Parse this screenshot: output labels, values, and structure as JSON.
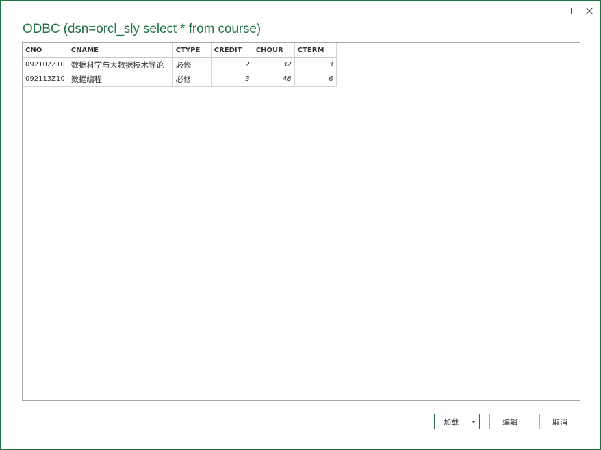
{
  "window": {
    "title": "ODBC (dsn=orcl_sly select * from course)",
    "accent_color": "#217346"
  },
  "controls": {
    "maximize_icon": "maximize-icon",
    "close_icon": "close-icon",
    "close_glyph": "✕"
  },
  "table": {
    "columns": [
      "CNO",
      "CNAME",
      "CTYPE",
      "CREDIT",
      "CHOUR",
      "CTERM"
    ],
    "rows": [
      {
        "cno": "092102Z10",
        "cname": "数据科学与大数据技术导论",
        "ctype": "必修",
        "credit": "2",
        "chour": "32",
        "cterm": "3"
      },
      {
        "cno": "092113Z10",
        "cname": "数据编程",
        "ctype": "必修",
        "credit": "3",
        "chour": "48",
        "cterm": "6"
      }
    ]
  },
  "buttons": {
    "load": "加载",
    "edit": "编辑",
    "cancel": "取消"
  }
}
